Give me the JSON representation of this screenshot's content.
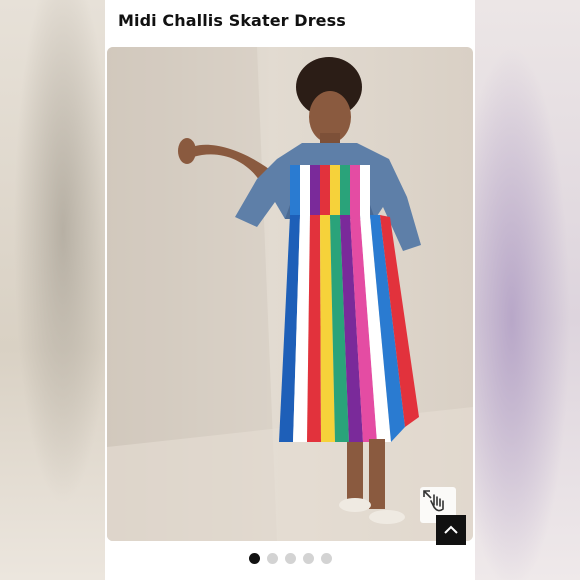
{
  "product": {
    "title": "Midi Challis Skater Dress"
  },
  "gallery": {
    "image_description_icon": "product-photo",
    "expand_icon": "expand-hand-icon",
    "scroll_top_icon": "chevron-up-icon",
    "dots": [
      {
        "active": true
      },
      {
        "active": false
      },
      {
        "active": false
      },
      {
        "active": false
      },
      {
        "active": false
      }
    ]
  },
  "colors": {
    "accent": "#111111",
    "dot_inactive": "#d3d3d3"
  }
}
